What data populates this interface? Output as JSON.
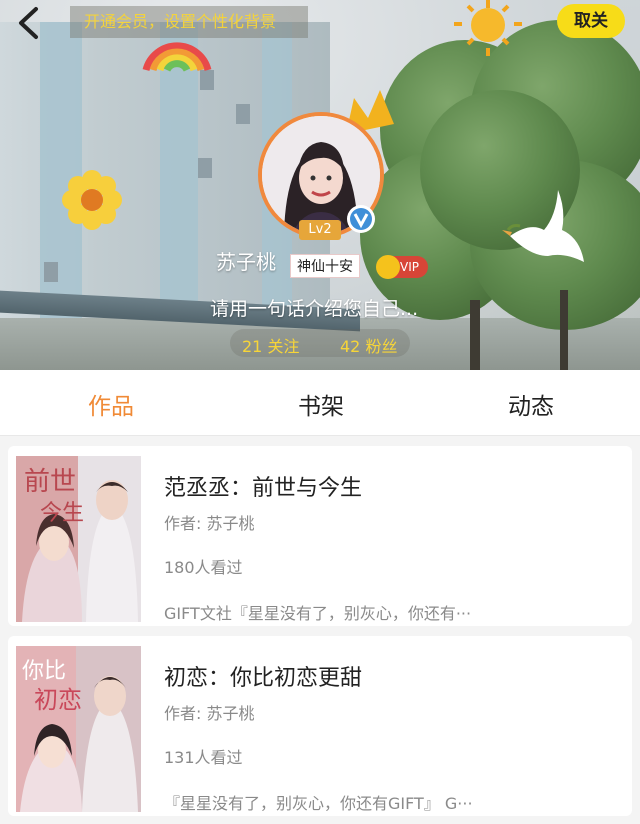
{
  "header": {
    "back_icon": "chevron-left-icon",
    "vip_tip": "开通会员，设置个性化背景",
    "close_label": "取关",
    "close_color": "#f7dc18",
    "level": "Lv2",
    "username": "苏子桃",
    "title_tag": "神仙十安",
    "vip_label": "VIP",
    "bio": "请用一句话介绍您自己...",
    "follows": "21 关注",
    "fans": "42 粉丝",
    "stat_color": "#f7d538"
  },
  "tabs": [
    {
      "label": "作品",
      "active": true
    },
    {
      "label": "书架",
      "active": false
    },
    {
      "label": "动态",
      "active": false
    }
  ],
  "accent_color": "#f08a36",
  "books": [
    {
      "title": "范丞丞：前世与今生",
      "author": "作者: 苏子桃",
      "views": "180人看过",
      "desc": "GIFT文社『星星没有了，别灰心，你还有···"
    },
    {
      "title": "初恋：你比初恋更甜",
      "author": "作者: 苏子桃",
      "views": "131人看过",
      "desc": "『星星没有了，别灰心，你还有GIFT』 G···"
    }
  ]
}
